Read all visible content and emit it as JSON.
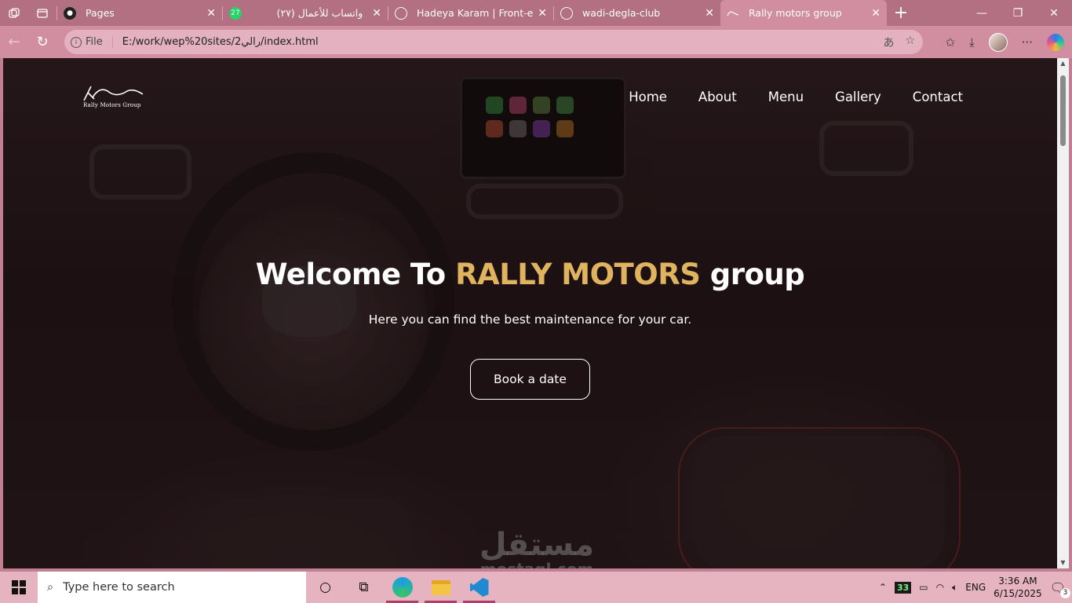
{
  "browser": {
    "tabs": [
      {
        "title": "Pages",
        "icon": "github-icon",
        "active": false
      },
      {
        "title": "واتساب للأعمال (٢٧)",
        "icon": "whatsapp-icon",
        "badge": "27",
        "active": false
      },
      {
        "title": "Hadeya Karam | Front-end D",
        "icon": "globe-icon",
        "active": false
      },
      {
        "title": "wadi-degla-club",
        "icon": "globe-icon",
        "active": false
      },
      {
        "title": "Rally motors group",
        "icon": "rally-logo-icon",
        "active": true
      }
    ],
    "address": {
      "scheme_label": "File",
      "url": "E:/work/wep%20sites/رالي2/index.html"
    }
  },
  "site": {
    "logo_text": "Rally Motors Group",
    "nav": [
      "Home",
      "About",
      "Menu",
      "Gallery",
      "Contact"
    ],
    "hero": {
      "title_before": "Welcome To ",
      "title_accent": "RALLY MOTORS",
      "title_after": " group",
      "subtitle": "Here you can find the best maintenance for your car.",
      "cta": "Book a date"
    },
    "accent_color": "#e0b35e",
    "watermark": {
      "arabic": "مستقل",
      "latin": "mostaql.com"
    }
  },
  "taskbar": {
    "search_placeholder": "Type here to search",
    "tray_badge": "33",
    "language": "ENG",
    "time": "3:36 AM",
    "date": "6/15/2025",
    "notifications": "3"
  }
}
